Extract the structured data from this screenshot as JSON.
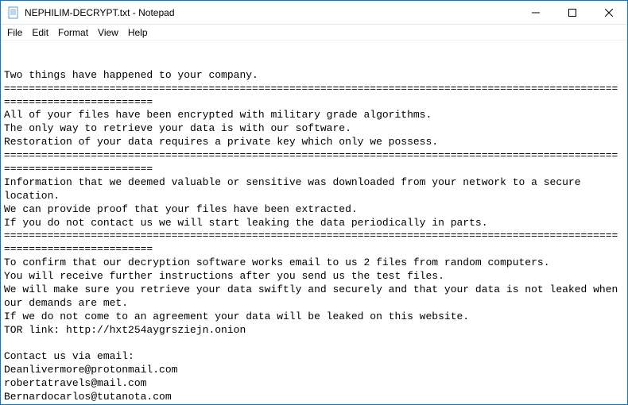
{
  "titlebar": {
    "title": "NEPHILIM-DECRYPT.txt - Notepad"
  },
  "menubar": {
    "file": "File",
    "edit": "Edit",
    "format": "Format",
    "view": "View",
    "help": "Help"
  },
  "content": {
    "text": "Two things have happened to your company.\n===========================================================================================================================\nAll of your files have been encrypted with military grade algorithms.\nThe only way to retrieve your data is with our software.\nRestoration of your data requires a private key which only we possess.\n===========================================================================================================================\nInformation that we deemed valuable or sensitive was downloaded from your network to a secure location.\nWe can provide proof that your files have been extracted.\nIf you do not contact us we will start leaking the data periodically in parts.\n===========================================================================================================================\nTo confirm that our decryption software works email to us 2 files from random computers.\nYou will receive further instructions after you send us the test files.\nWe will make sure you retrieve your data swiftly and securely and that your data is not leaked when our demands are met.\nIf we do not come to an agreement your data will be leaked on this website.\nTOR link: http://hxt254aygrsziejn.onion\n\nContact us via email:\nDeanlivermore@protonmail.com\nrobertatravels@mail.com\nBernardocarlos@tutanota.com"
  }
}
